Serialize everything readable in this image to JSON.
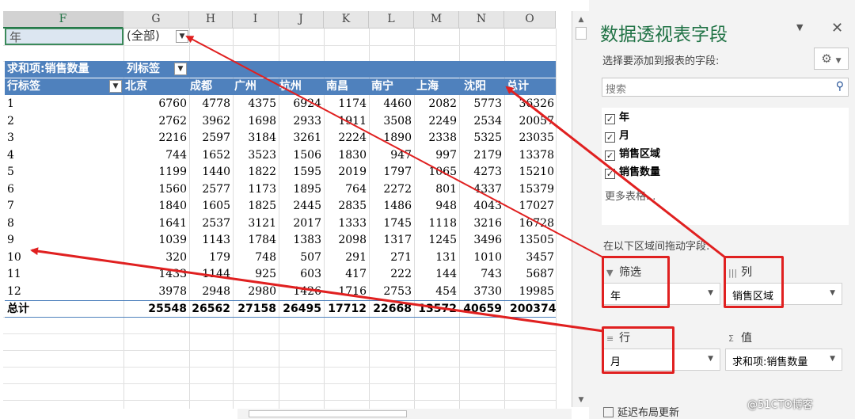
{
  "sheet": {
    "columns": [
      "F",
      "G",
      "H",
      "I",
      "J",
      "K",
      "L",
      "M",
      "N",
      "O"
    ],
    "filter_label": "年",
    "filter_value": "(全部)",
    "header_row1_label": "求和项:销售数量",
    "header_row1_col_label": "列标签",
    "header_row2_label": "行标签",
    "cities": [
      "北京",
      "成都",
      "广州",
      "杭州",
      "南昌",
      "南宁",
      "上海",
      "沈阳",
      "总计"
    ],
    "rows": [
      {
        "label": "1",
        "values": [
          "6760",
          "4778",
          "4375",
          "6924",
          "1174",
          "4460",
          "2082",
          "5773",
          "36326"
        ]
      },
      {
        "label": "2",
        "values": [
          "2762",
          "3962",
          "1698",
          "2933",
          "1911",
          "3508",
          "2249",
          "2534",
          "20057"
        ]
      },
      {
        "label": "3",
        "values": [
          "2216",
          "2597",
          "3184",
          "3261",
          "2224",
          "1890",
          "2338",
          "5325",
          "23035"
        ]
      },
      {
        "label": "4",
        "values": [
          "744",
          "1652",
          "3523",
          "1506",
          "1830",
          "947",
          "997",
          "2179",
          "13378"
        ]
      },
      {
        "label": "5",
        "values": [
          "1199",
          "1440",
          "1822",
          "1595",
          "2019",
          "1797",
          "1065",
          "4273",
          "15210"
        ]
      },
      {
        "label": "6",
        "values": [
          "1560",
          "2577",
          "1173",
          "1895",
          "764",
          "2272",
          "801",
          "4337",
          "15379"
        ]
      },
      {
        "label": "7",
        "values": [
          "1840",
          "1605",
          "1825",
          "2445",
          "2835",
          "1486",
          "948",
          "4043",
          "17027"
        ]
      },
      {
        "label": "8",
        "values": [
          "1641",
          "2537",
          "3121",
          "2017",
          "1333",
          "1745",
          "1118",
          "3216",
          "16728"
        ]
      },
      {
        "label": "9",
        "values": [
          "1039",
          "1143",
          "1784",
          "1383",
          "2098",
          "1317",
          "1245",
          "3496",
          "13505"
        ]
      },
      {
        "label": "10",
        "values": [
          "320",
          "179",
          "748",
          "507",
          "291",
          "271",
          "131",
          "1010",
          "3457"
        ]
      },
      {
        "label": "11",
        "values": [
          "1433",
          "1144",
          "925",
          "603",
          "417",
          "222",
          "144",
          "743",
          "5687"
        ]
      },
      {
        "label": "12",
        "values": [
          "3978",
          "2948",
          "2980",
          "1426",
          "1716",
          "2753",
          "454",
          "3730",
          "19985"
        ]
      }
    ],
    "total": {
      "label": "总计",
      "values": [
        "25548",
        "26562",
        "27158",
        "26495",
        "17712",
        "22668",
        "13572",
        "40659",
        "200374"
      ]
    }
  },
  "pane": {
    "title": "数据透视表字段",
    "subtitle": "选择要添加到报表的字段:",
    "search_placeholder": "搜索",
    "fields": [
      {
        "name": "年",
        "checked": true
      },
      {
        "name": "月",
        "checked": true
      },
      {
        "name": "销售区域",
        "checked": true
      },
      {
        "name": "销售数量",
        "checked": true
      }
    ],
    "more_tables": "更多表格...",
    "drag_label": "在以下区域间拖动字段:",
    "areas": {
      "filter": {
        "title": "筛选",
        "value": "年"
      },
      "columns": {
        "title": "列",
        "value": "销售区域"
      },
      "rows": {
        "title": "行",
        "value": "月"
      },
      "values": {
        "title": "值",
        "value": "求和项:销售数量"
      }
    },
    "defer_label": "延迟布局更新",
    "watermark": "@51CTO博客"
  },
  "colors": {
    "accent": "#217346",
    "pivot_header": "#4f81bd",
    "annotation": "#e02020"
  }
}
